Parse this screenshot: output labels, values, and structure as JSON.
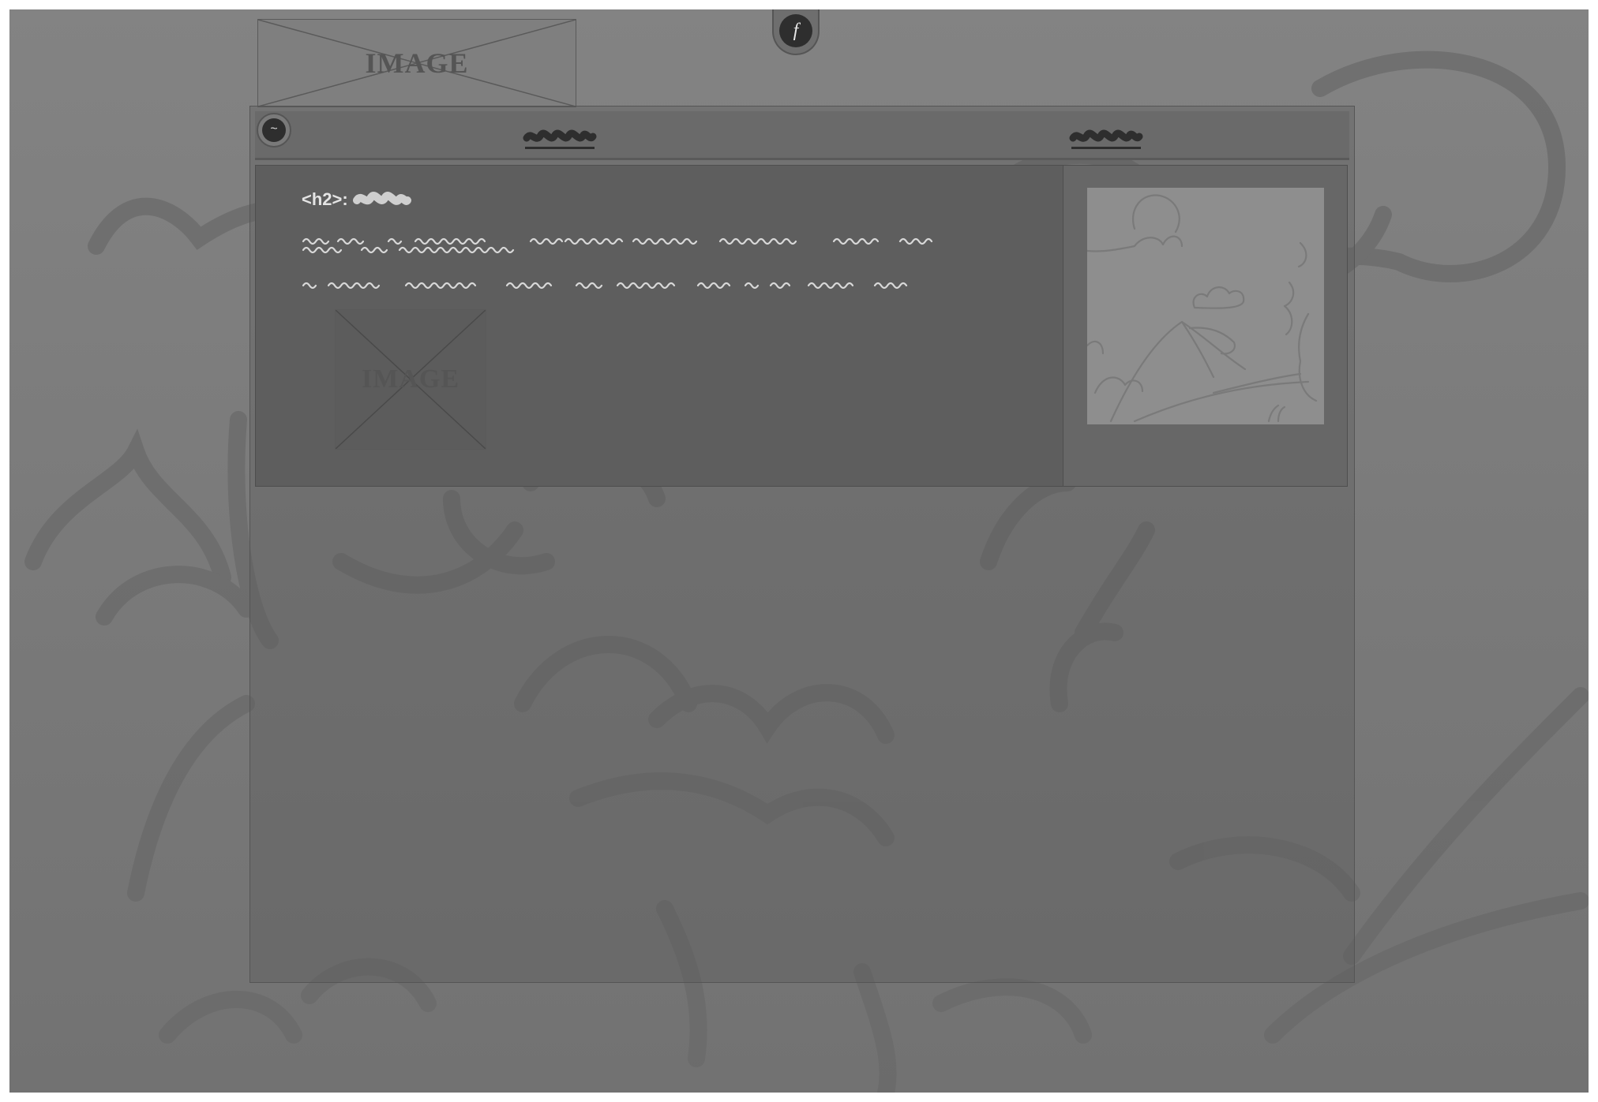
{
  "logo": {
    "label": "IMAGE"
  },
  "social": {
    "facebook_glyph": "f",
    "icon": "facebook-icon"
  },
  "topbar": {
    "menu_icon": "menu-icon",
    "menu_glyph": "~",
    "nav_links": [
      {
        "name": "nav-link-1",
        "label": ""
      },
      {
        "name": "nav-link-2",
        "label": ""
      }
    ]
  },
  "main": {
    "heading_tag": "<h2>:",
    "heading_text": "",
    "content_image_label": "IMAGE"
  },
  "sidebar": {
    "image_icon": "landscape-illustration"
  },
  "colors": {
    "background": "#7a7a7a",
    "panel": "#5e5e5e",
    "sidebar": "#676767",
    "text": "#e4e4e4",
    "scribble_dark": "#2e2e2e"
  }
}
